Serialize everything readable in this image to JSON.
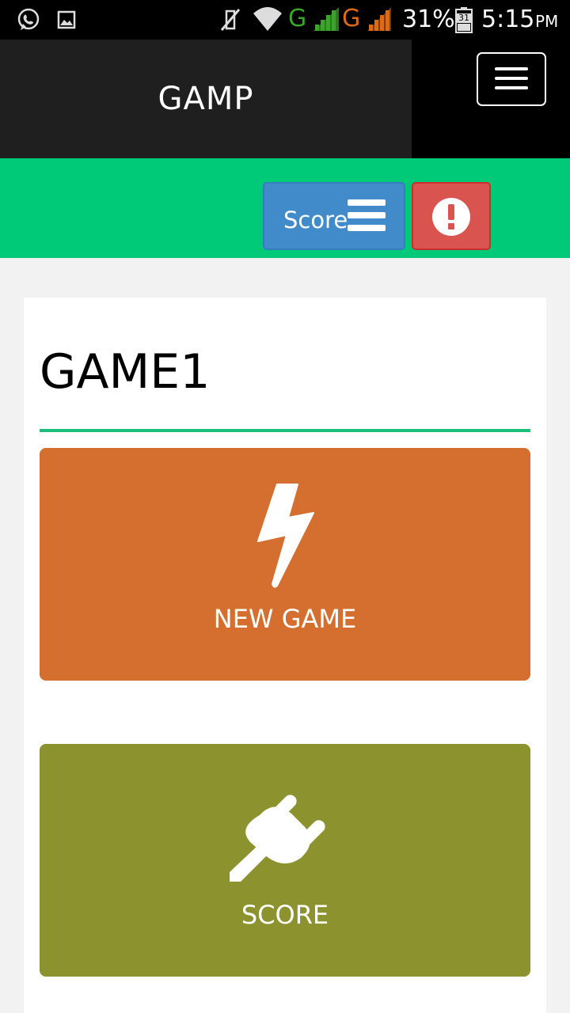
{
  "status_bar": {
    "network1": "G",
    "network2": "G",
    "battery": "31%",
    "calendar_day": "31",
    "time": "5:15",
    "ampm": "PM",
    "icons": [
      "whatsapp-icon",
      "image-icon",
      "mute-icon",
      "wifi-icon",
      "signal-icon",
      "battery-icon"
    ],
    "colors": {
      "g1": "#3aa52a",
      "g2": "#e06a12"
    }
  },
  "header": {
    "brand": "GAMP",
    "menu_icon": "hamburger-icon"
  },
  "toolbar": {
    "score_label": "Score",
    "score_icon": "list-icon",
    "alert_icon": "exclamation-circle-icon",
    "colors": {
      "bar": "#00c977",
      "score": "#428bca",
      "alert": "#d9534f"
    }
  },
  "main": {
    "title": "GAME1",
    "tiles": [
      {
        "label": "NEW GAME",
        "icon": "lightning-icon",
        "color": "#d46f2f"
      },
      {
        "label": "SCORE",
        "icon": "plug-icon",
        "color": "#8c922e"
      }
    ]
  }
}
